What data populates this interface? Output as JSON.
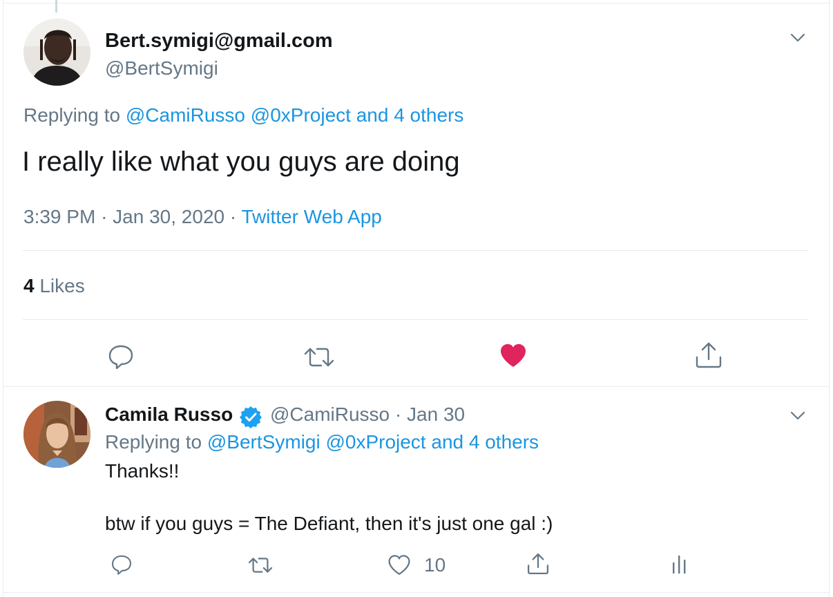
{
  "main_tweet": {
    "display_name": "Bert.symigi@gmail.com",
    "handle": "@BertSymigi",
    "replying_prefix": "Replying to",
    "replying_users": "@CamiRusso @0xProject",
    "replying_and": "and",
    "replying_others": "4 others",
    "text": "I really like what you guys are doing",
    "time": "3:39 PM",
    "sep1": "·",
    "date": "Jan 30, 2020",
    "sep2": "·",
    "source": "Twitter Web App",
    "likes_count": "4",
    "likes_label": "Likes",
    "liked": true
  },
  "reply_tweet": {
    "display_name": "Camila Russo",
    "verified": true,
    "handle": "@CamiRusso",
    "sep": "·",
    "date": "Jan 30",
    "replying_prefix": "Replying to",
    "replying_users": "@BertSymigi @0xProject",
    "replying_and": "and",
    "replying_others": "4 others",
    "text_line1": "Thanks!!",
    "text_line2": "btw if you guys = The Defiant, then it's just one gal :)",
    "like_count": "10"
  },
  "colors": {
    "link": "#1b95e0",
    "muted": "#657786",
    "like": "#e0245e",
    "verified": "#1da1f2",
    "divider": "#e6ecf0"
  },
  "icons": [
    "chevron-down-icon",
    "reply-icon",
    "retweet-icon",
    "heart-icon",
    "share-icon",
    "analytics-icon",
    "verified-badge-icon"
  ]
}
